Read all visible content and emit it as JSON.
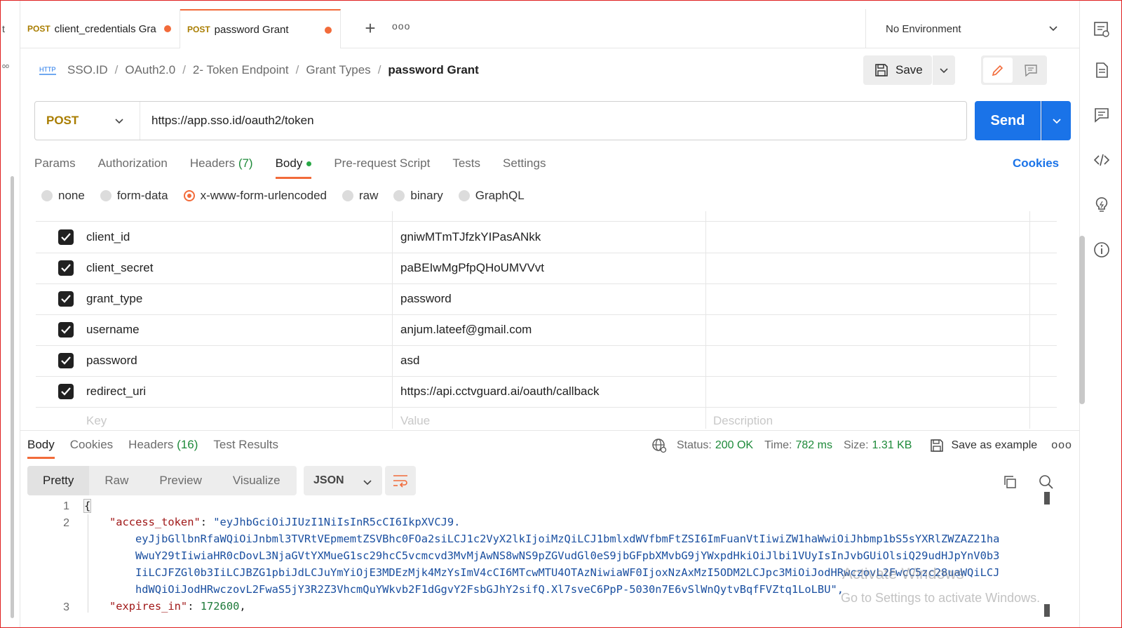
{
  "tabs": [
    {
      "method": "POST",
      "title": "client_credentials Gra",
      "unsaved": true
    },
    {
      "method": "POST",
      "title": "password Grant",
      "unsaved": true,
      "active": true
    }
  ],
  "left_sliver_char": "t",
  "environment": "No Environment",
  "breadcrumb": [
    "SSO.ID",
    "OAuth2.0",
    "2- Token Endpoint",
    "Grant Types",
    "password Grant"
  ],
  "http_icon_text": "HTTP",
  "toolbar": {
    "save_label": "Save"
  },
  "request": {
    "method": "POST",
    "url": "https://app.sso.id/oauth2/token",
    "send_label": "Send"
  },
  "request_tabs": [
    {
      "label": "Params"
    },
    {
      "label": "Authorization"
    },
    {
      "label": "Headers",
      "count": "(7)"
    },
    {
      "label": "Body",
      "active": true
    },
    {
      "label": "Pre-request Script"
    },
    {
      "label": "Tests"
    },
    {
      "label": "Settings"
    }
  ],
  "cookies_label": "Cookies",
  "body_types": [
    {
      "label": "none"
    },
    {
      "label": "form-data"
    },
    {
      "label": "x-www-form-urlencoded",
      "selected": true
    },
    {
      "label": "raw"
    },
    {
      "label": "binary"
    },
    {
      "label": "GraphQL"
    }
  ],
  "params": [
    {
      "key": "client_id",
      "value": "gniwMTmTJfzkYIPasANkk",
      "checked": true
    },
    {
      "key": "client_secret",
      "value": "paBEIwMgPfpQHoUMVVvt",
      "checked": true
    },
    {
      "key": "grant_type",
      "value": "password",
      "checked": true
    },
    {
      "key": "username",
      "value": "anjum.lateef@gmail.com",
      "checked": true
    },
    {
      "key": "password",
      "value": "asd",
      "checked": true
    },
    {
      "key": "redirect_uri",
      "value": "https://api.cctvguard.ai/oauth/callback",
      "checked": true
    }
  ],
  "params_placeholders": {
    "key": "Key",
    "value": "Value",
    "description": "Description"
  },
  "response_tabs": [
    {
      "label": "Body",
      "active": true
    },
    {
      "label": "Cookies"
    },
    {
      "label": "Headers",
      "count": "(16)"
    },
    {
      "label": "Test Results"
    }
  ],
  "response_stats": {
    "status_label": "Status:",
    "status": "200 OK",
    "time_label": "Time:",
    "time": "782 ms",
    "size_label": "Size:",
    "size": "1.31 KB",
    "save_example": "Save as example"
  },
  "view_tabs": [
    "Pretty",
    "Raw",
    "Preview",
    "Visualize"
  ],
  "format": "JSON",
  "code": {
    "line_numbers": [
      "1",
      "2",
      "3"
    ],
    "brace": "{",
    "access_key": "\"access_token\"",
    "token_lines": [
      "\"eyJhbGciOiJIUzI1NiIsInR5cCI6IkpXVCJ9.",
      "eyJjbGllbnRfaWQiOiJnbml3TVRtVEpmemtZSVBhc0FOa2siLCJ1c2VyX2lkIjoiMzQiLCJ1bmlxdWVfbmFtZSI6ImFuanVtIiwiZW1haWwiOiJhbmp1bS5sYXRlZWZAZ21ha",
      "WwuY29tIiwiaHR0cDovL3NjaGVtYXMueG1sc29hcC5vcmcvd3MvMjAwNS8wNS9pZGVudGl0eS9jbGFpbXMvbG9jYWxpdHkiOiJlbi1VUyIsInJvbGUiOlsiQ29udHJpYnV0b3",
      "IiLCJFZGl0b3IiLCJBZG1pbiJdLCJuYmYiOjE3MDEzMjk4MzYsImV4cCI6MTcwMTU4OTAzNiwiaWF0IjoxNzAxMzI5ODM2LCJpc3MiOiJodHRwczovL2FwcC5zc28uaWQiLCJ",
      "hdWQiOiJodHRwczovL2FwaS5jY3R2Z3VhcmQuYWkvb2F1dGgvY2FsbGJhY2sifQ.Xl7sveC6PpP-5030n7E6vSlWnQytvBqfFVZtq1LoLBU\","
    ],
    "expires_key": "\"expires_in\"",
    "expires_value": "172600"
  },
  "watermark": [
    "Activate Windows",
    "Go to Settings to activate Windows."
  ]
}
